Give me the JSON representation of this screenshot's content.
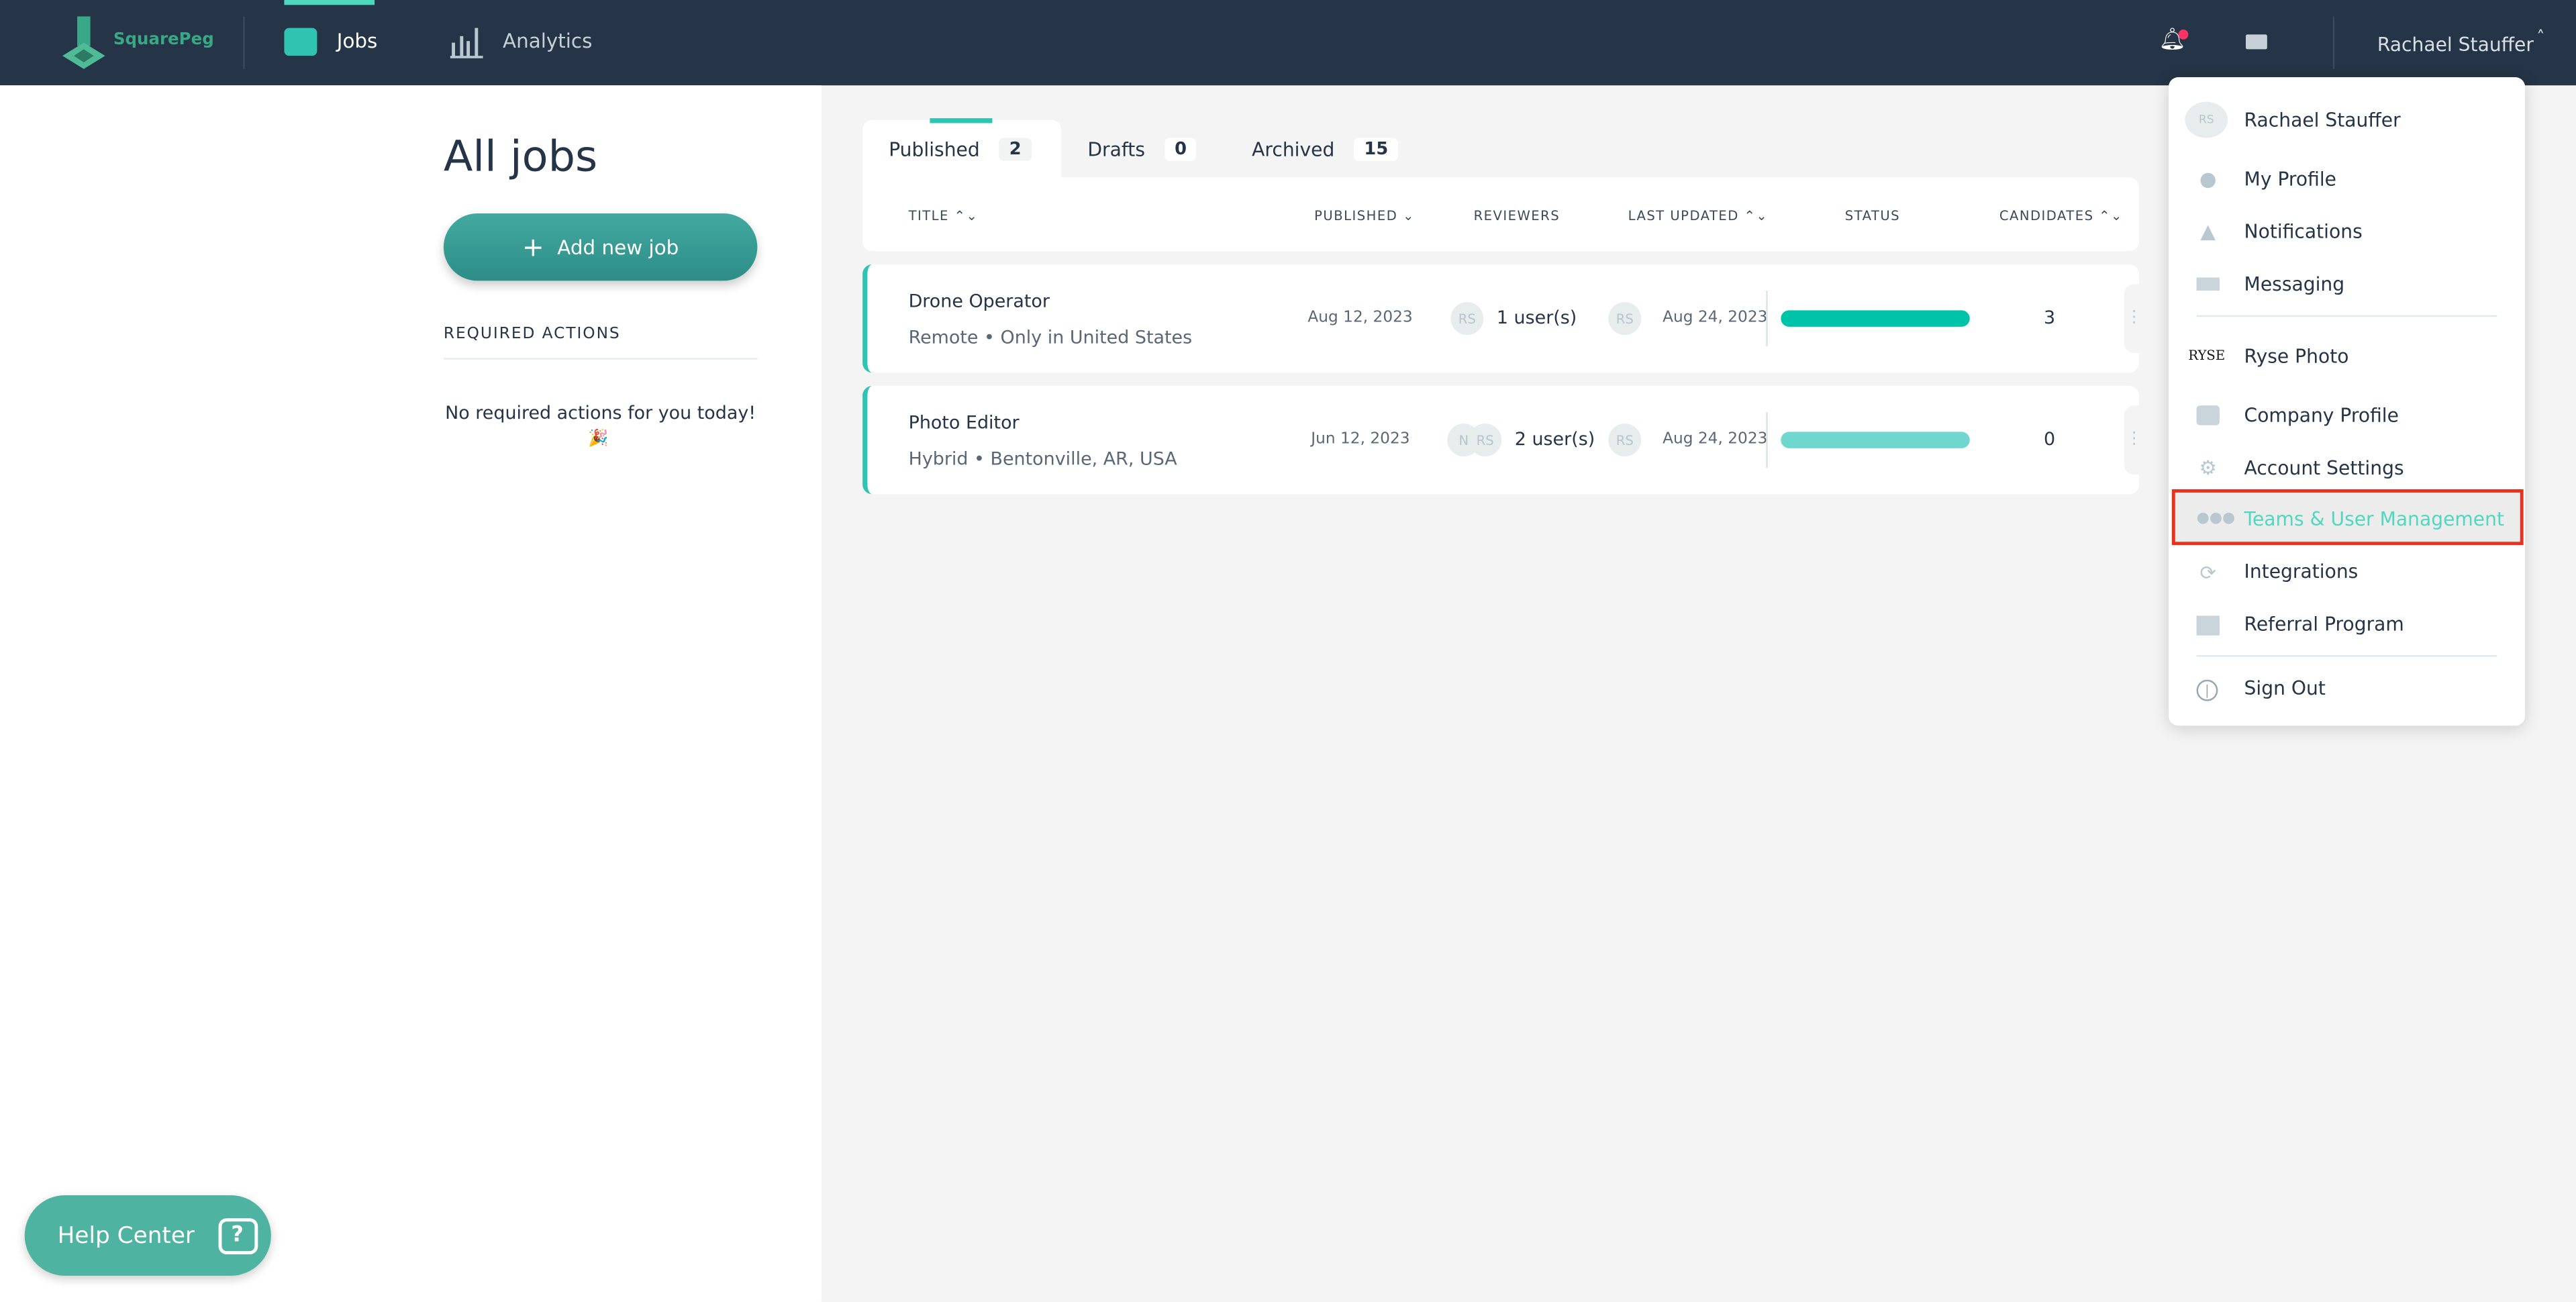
{
  "header": {
    "logo": "SquarePeg",
    "nav": [
      {
        "label": "Jobs",
        "active": true
      },
      {
        "label": "Analytics"
      }
    ],
    "user_name": "Rachael Stauffer",
    "has_notification": true
  },
  "sidebar": {
    "title": "All jobs",
    "add_button": "Add new job",
    "required_actions_heading": "REQUIRED ACTIONS",
    "empty_message": "No required actions for you today!",
    "empty_emoji": "🎉",
    "help_center": "Help Center"
  },
  "tabs": [
    {
      "label": "Published",
      "count": "2",
      "active": true
    },
    {
      "label": "Drafts",
      "count": "0"
    },
    {
      "label": "Archived",
      "count": "15"
    }
  ],
  "table": {
    "columns": [
      "TITLE",
      "PUBLISHED",
      "REVIEWERS",
      "LAST UPDATED",
      "STATUS",
      "CANDIDATES"
    ],
    "rows": [
      {
        "title": "Drone Operator",
        "work_type": "Remote",
        "location": "Only in United States",
        "published": "Aug 12, 2023",
        "reviewer_avatars": [
          "RS"
        ],
        "reviewers": "1 user(s)",
        "updated_avatar": "RS",
        "last_updated": "Aug 24, 2023",
        "status_color": "#00c4aa",
        "candidates": "3"
      },
      {
        "title": "Photo Editor",
        "work_type": "Hybrid",
        "location": "Bentonville, AR, USA",
        "published": "Jun 12, 2023",
        "reviewer_avatars": [
          "N",
          "RS"
        ],
        "reviewers": "2 user(s)",
        "updated_avatar": "RS",
        "last_updated": "Aug 24, 2023",
        "status_color": "#6fd7cd",
        "candidates": "0"
      }
    ]
  },
  "menu": {
    "avatar": "RS",
    "name": "Rachael Stauffer",
    "company_logo": "RYSE",
    "items": [
      {
        "label": "My Profile",
        "icon": "person-icon"
      },
      {
        "label": "Notifications",
        "icon": "bell-icon"
      },
      {
        "label": "Messaging",
        "icon": "envelope-icon"
      },
      {
        "label": "Ryse Photo",
        "icon": "company-logo"
      },
      {
        "label": "Company Profile",
        "icon": "building-icon"
      },
      {
        "label": "Account Settings",
        "icon": "gear-icon"
      },
      {
        "label": "Teams & User Management",
        "icon": "team-icon",
        "highlighted": true
      },
      {
        "label": "Integrations",
        "icon": "sync-icon"
      },
      {
        "label": "Referral Program",
        "icon": "gift-icon"
      },
      {
        "label": "Sign Out",
        "icon": "power-icon"
      }
    ]
  },
  "colors": {
    "header": "#253446",
    "accent": "#2fc4b2",
    "highlight_border": "#e8321e"
  }
}
